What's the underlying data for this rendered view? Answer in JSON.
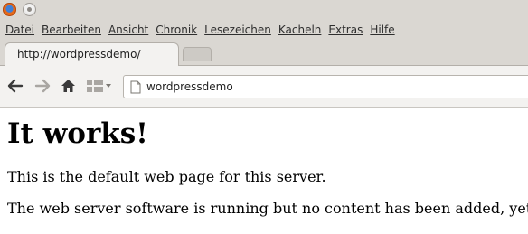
{
  "window": {
    "buttons": [
      "firefox-icon",
      "minimize-icon"
    ]
  },
  "menu": {
    "items": [
      "Datei",
      "Bearbeiten",
      "Ansicht",
      "Chronik",
      "Lesezeichen",
      "Kacheln",
      "Extras",
      "Hilfe"
    ]
  },
  "tabs": {
    "active_title": "http://wordpressdemo/"
  },
  "navigation": {
    "back_icon": "arrow-left-icon",
    "forward_icon": "arrow-right-icon",
    "home_icon": "home-icon",
    "view_icon": "grid-view-icon",
    "url": "wordpressdemo"
  },
  "page": {
    "heading": "It works!",
    "paragraph1": "This is the default web page for this server.",
    "paragraph2": "The web server software is running but no content has been added, yet."
  },
  "colors": {
    "chrome_bg": "#dad7d2",
    "toolbar_bg": "#f3f2f0",
    "page_bg": "#ffffff"
  }
}
